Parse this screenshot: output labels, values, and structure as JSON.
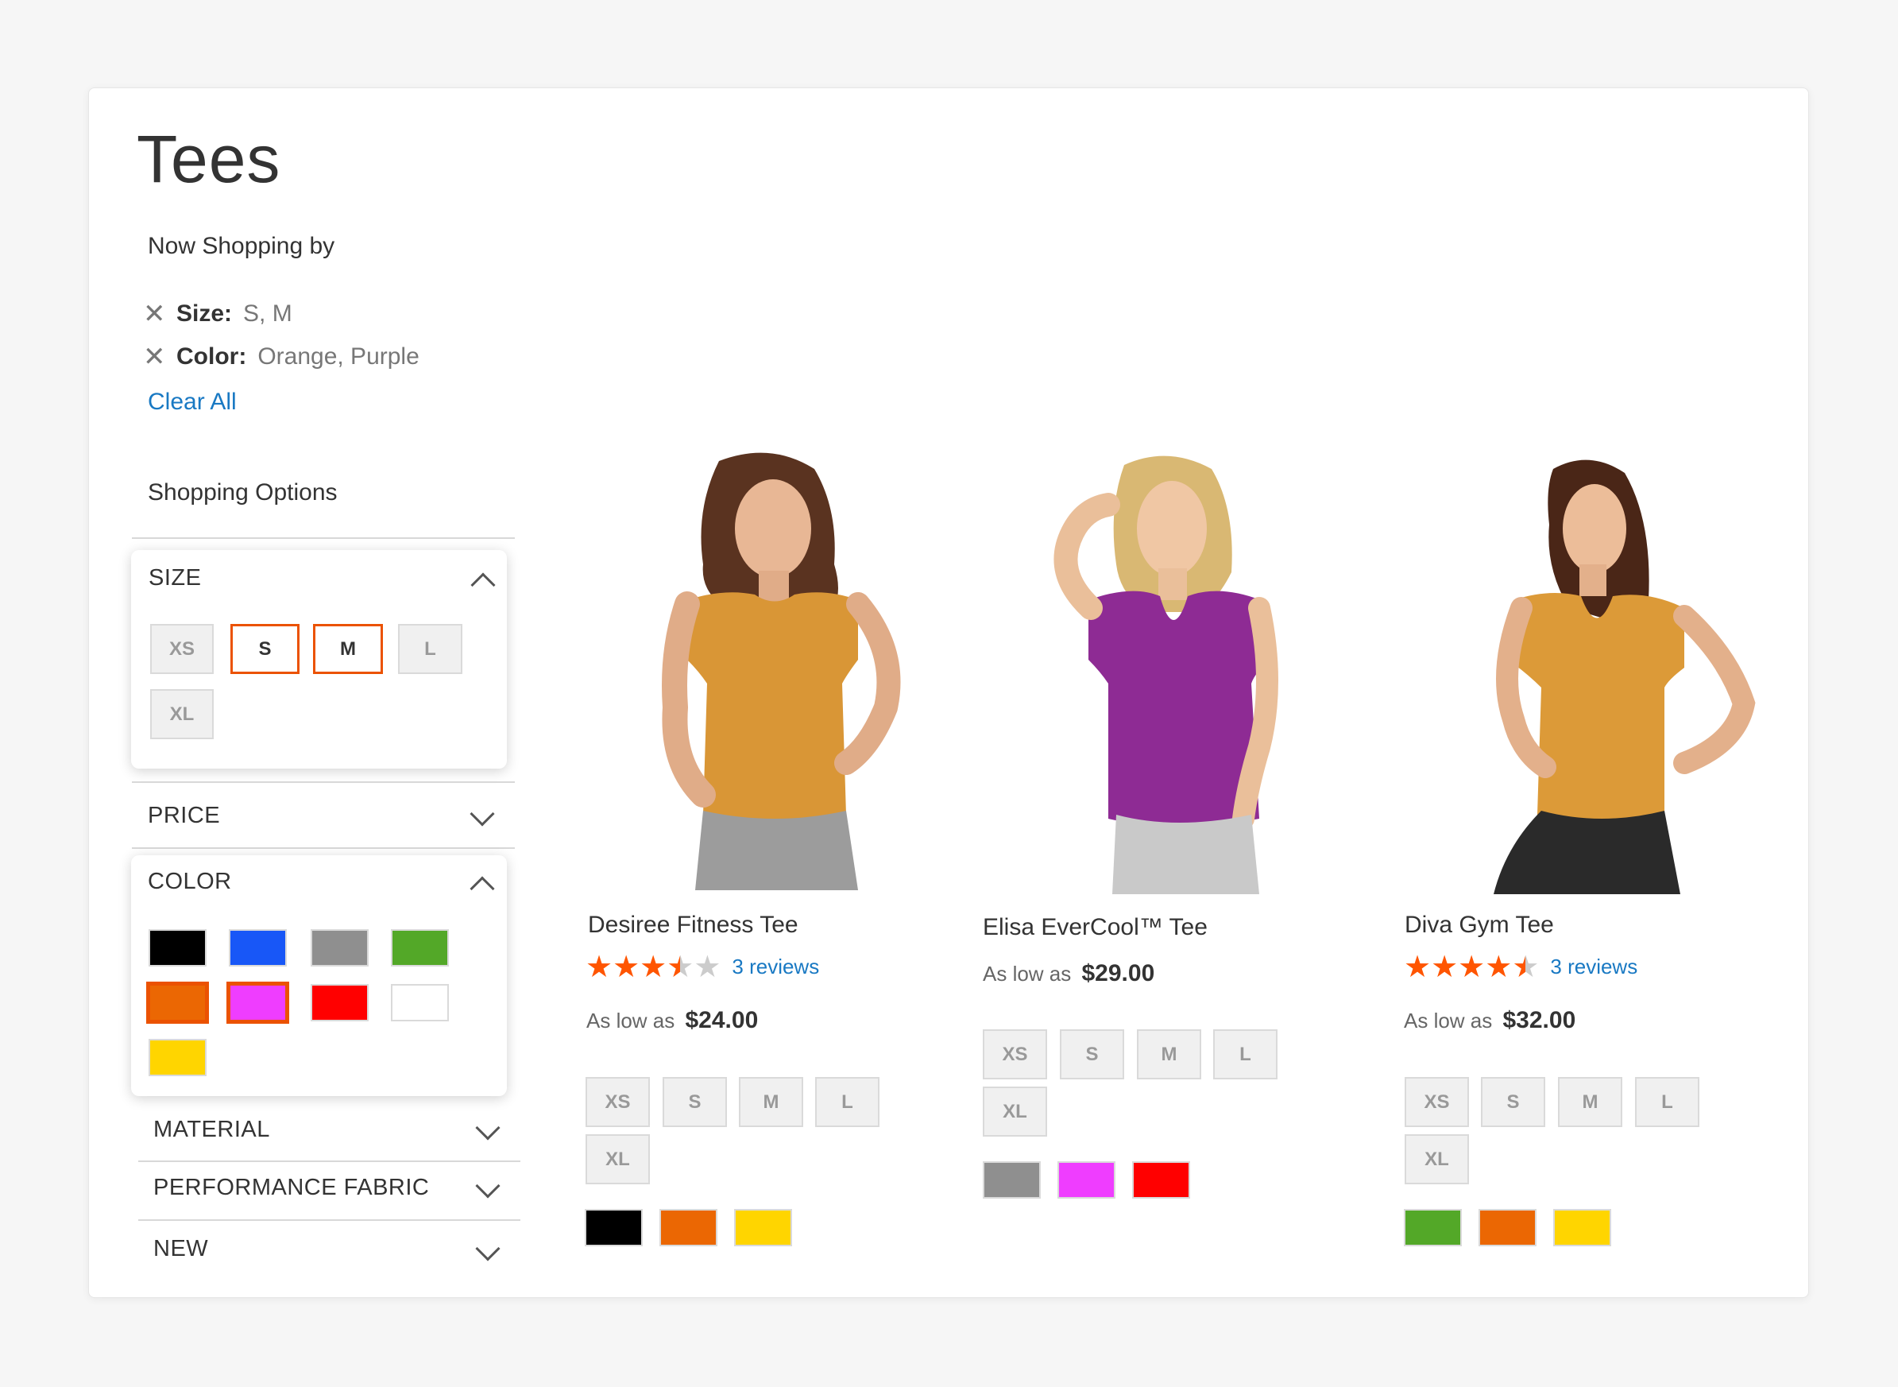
{
  "page": {
    "title": "Tees",
    "now_shopping_label": "Now Shopping by",
    "active_filters": [
      {
        "name": "Size:",
        "value": "S, M"
      },
      {
        "name": "Color:",
        "value": "Orange, Purple"
      }
    ],
    "clear_all_label": "Clear All",
    "shopping_options_label": "Shopping Options"
  },
  "filters": {
    "size": {
      "title": "SIZE",
      "options": [
        {
          "label": "XS",
          "selected": false
        },
        {
          "label": "S",
          "selected": true
        },
        {
          "label": "M",
          "selected": true
        },
        {
          "label": "L",
          "selected": false
        },
        {
          "label": "XL",
          "selected": false
        }
      ]
    },
    "price": {
      "title": "PRICE"
    },
    "color": {
      "title": "COLOR",
      "options": [
        {
          "name": "black",
          "hex": "#000000",
          "selected": false
        },
        {
          "name": "blue",
          "hex": "#1857f7",
          "selected": false
        },
        {
          "name": "gray",
          "hex": "#8f8f8f",
          "selected": false
        },
        {
          "name": "green",
          "hex": "#53a828",
          "selected": false
        },
        {
          "name": "orange",
          "hex": "#eb6703",
          "selected": true
        },
        {
          "name": "purple",
          "hex": "#ef3dff",
          "selected": true
        },
        {
          "name": "red",
          "hex": "#ff0000",
          "selected": false
        },
        {
          "name": "white",
          "hex": "#ffffff",
          "selected": false
        },
        {
          "name": "yellow",
          "hex": "#ffd500",
          "selected": false
        }
      ]
    },
    "material": {
      "title": "MATERIAL"
    },
    "performance_fabric": {
      "title": "PERFORMANCE FABRIC"
    },
    "new": {
      "title": "NEW"
    }
  },
  "products": [
    {
      "name": "Desiree Fitness Tee",
      "rating": 3.5,
      "reviews": "3 reviews",
      "price_prefix": "As low as",
      "price": "$24.00",
      "shirt_color": "#d99636",
      "sizes": [
        "XS",
        "S",
        "M",
        "L",
        "XL"
      ],
      "colors": [
        "#000000",
        "#eb6703",
        "#ffd500"
      ]
    },
    {
      "name": "Elisa EverCool™ Tee",
      "rating": null,
      "reviews": "",
      "price_prefix": "As low as",
      "price": "$29.00",
      "shirt_color": "#8e2b94",
      "sizes": [
        "XS",
        "S",
        "M",
        "L",
        "XL"
      ],
      "colors": [
        "#8f8f8f",
        "#ef3dff",
        "#ff0000"
      ]
    },
    {
      "name": "Diva Gym Tee",
      "rating": 4.5,
      "reviews": "3 reviews",
      "price_prefix": "As low as",
      "price": "$32.00",
      "shirt_color": "#dc9a38",
      "sizes": [
        "XS",
        "S",
        "M",
        "L",
        "XL"
      ],
      "colors": [
        "#53a828",
        "#eb6703",
        "#ffd500"
      ]
    }
  ]
}
